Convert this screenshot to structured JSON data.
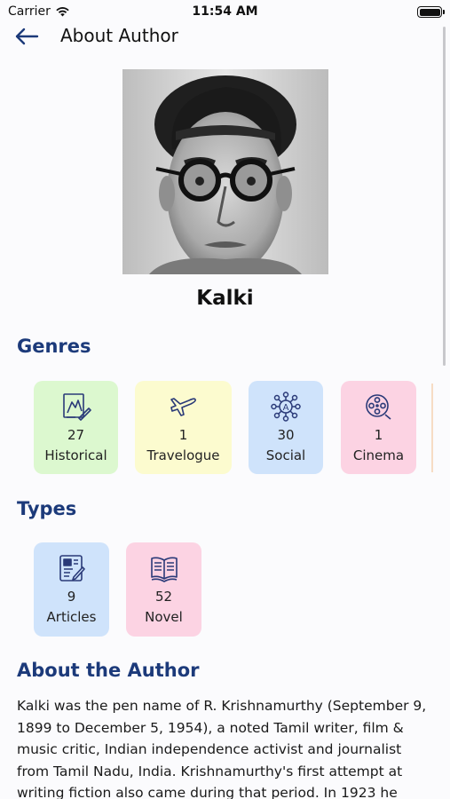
{
  "status_bar": {
    "carrier": "Carrier",
    "time": "11:54 AM"
  },
  "nav": {
    "title": "About Author"
  },
  "author": {
    "name": "Kalki"
  },
  "genres": {
    "title": "Genres",
    "items": [
      {
        "count": "27",
        "label": "Historical",
        "icon": "historical-icon",
        "color": "#dcf8cf"
      },
      {
        "count": "1",
        "label": "Travelogue",
        "icon": "airplane-icon",
        "color": "#fcfbcf"
      },
      {
        "count": "30",
        "label": "Social",
        "icon": "social-network-icon",
        "color": "#cfe3fb"
      },
      {
        "count": "1",
        "label": "Cinema",
        "icon": "film-reel-icon",
        "color": "#fcd3e3"
      }
    ]
  },
  "types": {
    "title": "Types",
    "items": [
      {
        "count": "9",
        "label": "Articles",
        "icon": "article-icon",
        "color": "#cfe3fb"
      },
      {
        "count": "52",
        "label": "Novel",
        "icon": "open-book-icon",
        "color": "#fcd3e3"
      }
    ]
  },
  "about": {
    "title": "About the Author",
    "text": "Kalki was the pen name of R. Krishnamurthy (September 9, 1899 to December 5, 1954), a noted Tamil writer, film & music critic, Indian independence activist and journalist from Tamil Nadu, India. Krishnamurthy's first attempt at writing fiction also came during that period. In 1923 he"
  },
  "colors": {
    "accent": "#1c3a7a",
    "icon_stroke": "#2a3a78"
  }
}
